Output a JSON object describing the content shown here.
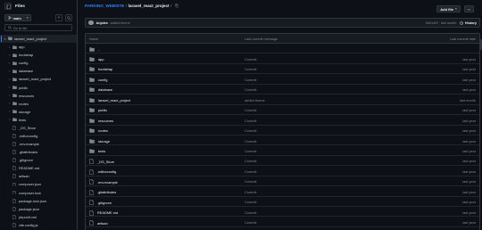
{
  "sidebar": {
    "title": "Files",
    "branch": "main",
    "search_placeholder": "Go to file",
    "tree": [
      {
        "label": "laravel_react_project",
        "type": "folder",
        "expanded": true,
        "depth": 0,
        "selected": true
      },
      {
        "label": "app",
        "type": "folder",
        "depth": 1
      },
      {
        "label": "bootstrap",
        "type": "folder",
        "depth": 1
      },
      {
        "label": "config",
        "type": "folder",
        "depth": 1
      },
      {
        "label": "database",
        "type": "folder",
        "depth": 1
      },
      {
        "label": "laravel_react_project",
        "type": "folder",
        "depth": 1
      },
      {
        "label": "public",
        "type": "folder",
        "depth": 1
      },
      {
        "label": "resources",
        "type": "folder",
        "depth": 1
      },
      {
        "label": "routes",
        "type": "folder",
        "depth": 1
      },
      {
        "label": "storage",
        "type": "folder",
        "depth": 1
      },
      {
        "label": "tests",
        "type": "folder",
        "depth": 1
      },
      {
        "label": "_DS_Store",
        "type": "file",
        "depth": 1
      },
      {
        "label": ".editorconfig",
        "type": "file",
        "depth": 1
      },
      {
        "label": ".env.example",
        "type": "file",
        "depth": 1
      },
      {
        "label": ".gitattributes",
        "type": "file",
        "depth": 1
      },
      {
        "label": ".gitignore",
        "type": "file",
        "depth": 1
      },
      {
        "label": "README.md",
        "type": "file",
        "depth": 1
      },
      {
        "label": "artisan",
        "type": "file",
        "depth": 1
      },
      {
        "label": "composer.json",
        "type": "file",
        "depth": 1
      },
      {
        "label": "composer.lock",
        "type": "file",
        "depth": 1
      },
      {
        "label": "package-lock.json",
        "type": "file",
        "depth": 1
      },
      {
        "label": "package.json",
        "type": "file",
        "depth": 1
      },
      {
        "label": "phpunit.xml",
        "type": "file",
        "depth": 1
      },
      {
        "label": "vite.config.js",
        "type": "file",
        "depth": 1
      }
    ]
  },
  "breadcrumb": {
    "repo": "PARKING_WEBSITE",
    "separator": "/",
    "folder": "laravel_react_project",
    "end_separator": "/"
  },
  "actions": {
    "add_file": "Add file",
    "more": "···"
  },
  "commit": {
    "author": "Anjalee",
    "message": "added theme",
    "hash": "5b6140f · last month",
    "history": "History"
  },
  "table": {
    "headers": {
      "name": "Name",
      "message": "Last commit message",
      "date": "Last commit date"
    },
    "rows": [
      {
        "name": "..",
        "type": "parent",
        "message": "",
        "date": ""
      },
      {
        "name": "app",
        "type": "folder",
        "message": "Commit",
        "date": "last year"
      },
      {
        "name": "bootstrap",
        "type": "folder",
        "message": "Commit",
        "date": "last year"
      },
      {
        "name": "config",
        "type": "folder",
        "message": "Commit",
        "date": "last year"
      },
      {
        "name": "database",
        "type": "folder",
        "message": "Commit",
        "date": "last year"
      },
      {
        "name": "laravel_react_project",
        "type": "folder",
        "message": "added theme",
        "date": "last month"
      },
      {
        "name": "public",
        "type": "folder",
        "message": "Commit",
        "date": "last year"
      },
      {
        "name": "resources",
        "type": "folder",
        "message": "Commit",
        "date": "last year"
      },
      {
        "name": "routes",
        "type": "folder",
        "message": "Commit",
        "date": "last year"
      },
      {
        "name": "storage",
        "type": "folder",
        "message": "Commit",
        "date": "last year"
      },
      {
        "name": "tests",
        "type": "folder",
        "message": "Commit",
        "date": "last year"
      },
      {
        "name": "_DS_Store",
        "type": "file",
        "message": "Commit",
        "date": "last year"
      },
      {
        "name": ".editorconfig",
        "type": "file",
        "message": "Commit",
        "date": "last year"
      },
      {
        "name": ".env.example",
        "type": "file",
        "message": "Commit",
        "date": "last year"
      },
      {
        "name": ".gitattributes",
        "type": "file",
        "message": "Commit",
        "date": "last year"
      },
      {
        "name": ".gitignore",
        "type": "file",
        "message": "Commit",
        "date": "last year"
      },
      {
        "name": "README.md",
        "type": "file",
        "message": "Commit",
        "date": "last year"
      },
      {
        "name": "artisan",
        "type": "file",
        "message": "Commit",
        "date": "last year"
      },
      {
        "name": "composer.json",
        "type": "file",
        "message": "Commit",
        "date": "last year"
      }
    ]
  },
  "colors": {
    "background": "#0d1117",
    "border": "#30363d",
    "link": "#2f81f7",
    "folder_icon": "#7d8590",
    "muted_text": "#7d8590"
  },
  "icons": {
    "sidebar_toggle": "sidebar-collapse-icon",
    "branch": "git-branch-icon",
    "search": "search-icon",
    "folder": "folder-icon",
    "file": "file-icon",
    "history": "clock-icon"
  }
}
